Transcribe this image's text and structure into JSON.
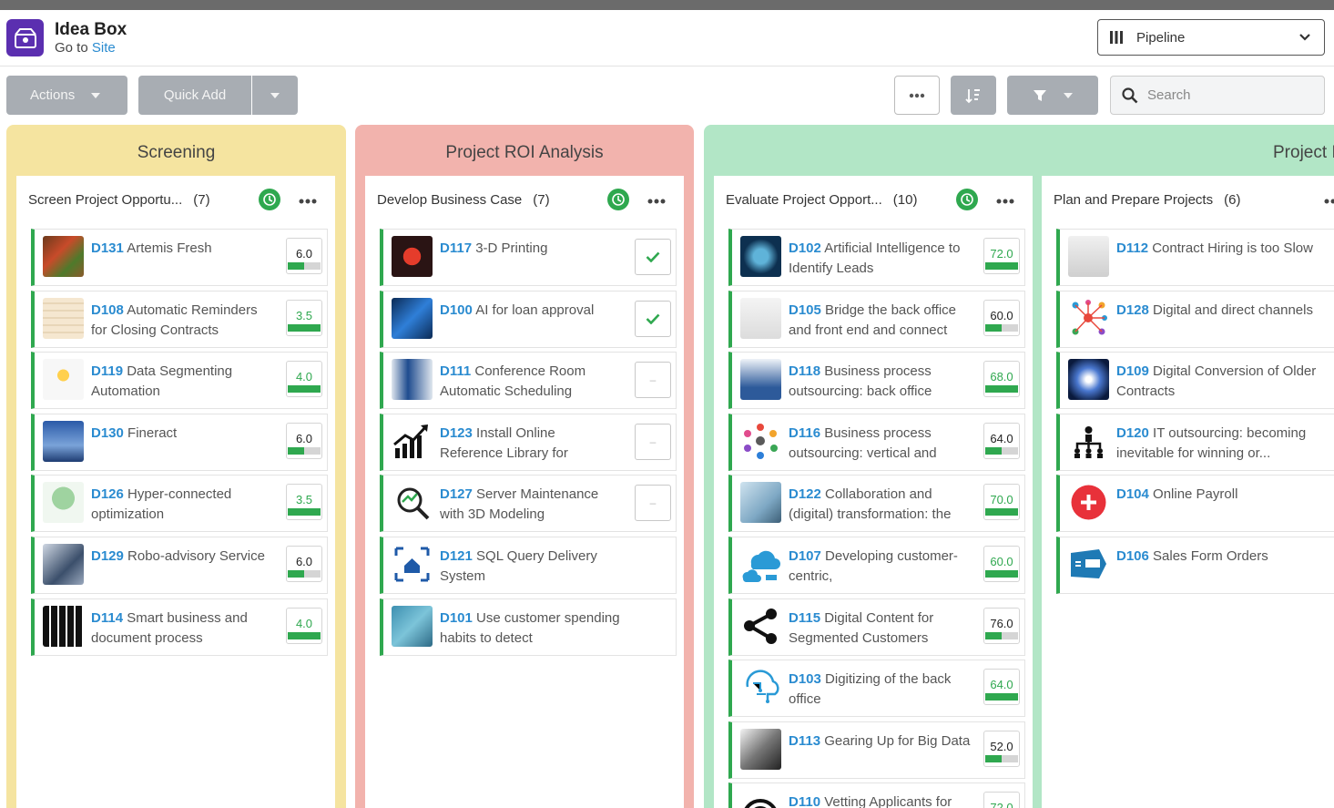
{
  "app": {
    "title": "Idea Box",
    "sub_prefix": "Go to",
    "sub_link": "Site",
    "view_select": "Pipeline"
  },
  "toolbar": {
    "actions_label": "Actions",
    "quick_add_label": "Quick Add",
    "search_placeholder": "Search"
  },
  "colors": {
    "stage_screening": "#f5e4a0",
    "stage_roi": "#f2b3ad",
    "stage_project": "#b2e6c6",
    "accent_green": "#2fa84f",
    "link_blue": "#2a8bd0"
  },
  "stages": [
    {
      "title": "Screening"
    },
    {
      "title": "Project ROI Analysis"
    },
    {
      "title": "Project I"
    }
  ],
  "columns": [
    {
      "name": "Screen Project Opportu...",
      "count": "(7)",
      "cards": [
        {
          "id": "D131",
          "title": "Artemis Fresh",
          "score": "6.0",
          "fill": 0.5,
          "icon": "vegetables-photo"
        },
        {
          "id": "D108",
          "title": "Automatic Reminders for Closing Contracts",
          "score": "3.5",
          "fill": 1.0,
          "icon": "dont-forget-photo"
        },
        {
          "id": "D119",
          "title": "Data Segmenting Automation",
          "score": "4.0",
          "fill": 1.0,
          "icon": "hands-network-photo"
        },
        {
          "id": "D130",
          "title": "Fineract",
          "score": "6.0",
          "fill": 0.5,
          "icon": "laptop-screen-photo"
        },
        {
          "id": "D126",
          "title": "Hyper-connected optimization",
          "score": "3.5",
          "fill": 1.0,
          "icon": "tree-network-photo"
        },
        {
          "id": "D129",
          "title": "Robo-advisory Service",
          "score": "6.0",
          "fill": 0.5,
          "icon": "robot-hand-photo"
        },
        {
          "id": "D114",
          "title": "Smart business and document process",
          "score": "4.0",
          "fill": 1.0,
          "icon": "binders-photo"
        }
      ]
    },
    {
      "name": "Develop Business Case",
      "count": "(7)",
      "cards": [
        {
          "id": "D117",
          "title": "3-D Printing",
          "mark": "check",
          "icon": "3d-printing-photo"
        },
        {
          "id": "D100",
          "title": "AI for loan approval",
          "mark": "check",
          "icon": "circuit-photo"
        },
        {
          "id": "D111",
          "title": "Conference Room Automatic Scheduling",
          "mark": "dash",
          "icon": "tablet-photo"
        },
        {
          "id": "D123",
          "title": "Install Online Reference Library for",
          "mark": "dash",
          "icon": "growth-chart-icon"
        },
        {
          "id": "D127",
          "title": "Server Maintenance with 3D Modeling",
          "mark": "dash",
          "icon": "magnifier-chart-icon"
        },
        {
          "id": "D121",
          "title": "SQL Query Delivery System",
          "mark": "none",
          "icon": "house-arrows-icon"
        },
        {
          "id": "D101",
          "title": "Use customer spending habits to detect",
          "mark": "none",
          "icon": "magnifier-fraud-photo"
        }
      ]
    },
    {
      "name": "Evaluate Project Opport...",
      "count": "(10)",
      "cards": [
        {
          "id": "D102",
          "title": "Artificial Intelligence to Identify Leads",
          "score": "72.0",
          "fill": 1.0,
          "icon": "ai-head-photo"
        },
        {
          "id": "D105",
          "title": "Bridge the back office and front end and connect",
          "score": "60.0",
          "fill": 0.5,
          "icon": "financial-diagram-photo"
        },
        {
          "id": "D118",
          "title": "Business process outsourcing: back office",
          "score": "68.0",
          "fill": 1.0,
          "icon": "back-office-photo"
        },
        {
          "id": "D116",
          "title": "Business process outsourcing: vertical and",
          "score": "64.0",
          "fill": 0.5,
          "icon": "colored-dots-icon"
        },
        {
          "id": "D122",
          "title": "Collaboration and (digital) transformation: the",
          "score": "70.0",
          "fill": 1.0,
          "icon": "woman-city-photo"
        },
        {
          "id": "D107",
          "title": "Developing customer-centric,",
          "score": "60.0",
          "fill": 1.0,
          "icon": "cloud-icon"
        },
        {
          "id": "D115",
          "title": "Digital Content for Segmented Customers",
          "score": "76.0",
          "fill": 0.5,
          "icon": "share-icon"
        },
        {
          "id": "D103",
          "title": "Digitizing of the back office",
          "score": "64.0",
          "fill": 1.0,
          "icon": "brain-circuit-icon"
        },
        {
          "id": "D113",
          "title": "Gearing Up for Big Data",
          "score": "52.0",
          "fill": 0.5,
          "icon": "usb-drive-photo"
        },
        {
          "id": "D110",
          "title": "Vetting Applicants for",
          "score": "72.0",
          "fill": 1.0,
          "icon": "target-icon"
        }
      ]
    },
    {
      "name": "Plan and Prepare Projects",
      "count": "(6)",
      "cards": [
        {
          "id": "D112",
          "title": "Contract Hiring is too Slow",
          "icon": "employment-paper-photo"
        },
        {
          "id": "D128",
          "title": "Digital and direct channels",
          "icon": "network-people-icon"
        },
        {
          "id": "D109",
          "title": "Digital Conversion of Older Contracts",
          "icon": "light-burst-photo"
        },
        {
          "id": "D120",
          "title": "IT outsourcing: becoming inevitable for winning or...",
          "icon": "org-chart-icon"
        },
        {
          "id": "D104",
          "title": "Online Payroll",
          "icon": "plus-circle-icon"
        },
        {
          "id": "D106",
          "title": "Sales Form Orders",
          "icon": "form-tag-icon"
        }
      ]
    }
  ]
}
